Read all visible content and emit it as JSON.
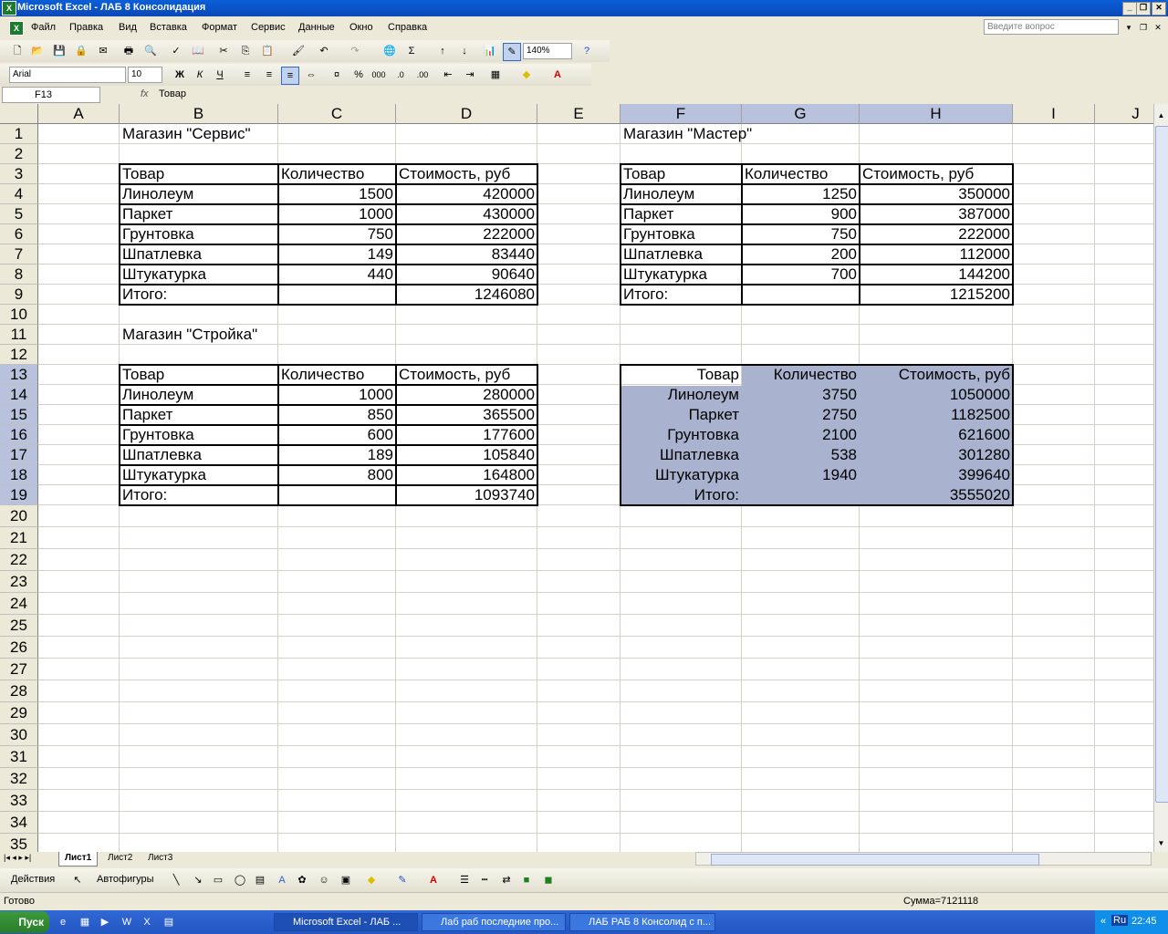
{
  "window": {
    "title": "Microsoft Excel - ЛАБ 8 Консолидация"
  },
  "menu": {
    "items": [
      "Файл",
      "Правка",
      "Вид",
      "Вставка",
      "Формат",
      "Сервис",
      "Данные",
      "Окно",
      "Справка"
    ],
    "help_placeholder": "Введите вопрос"
  },
  "toolbar": {
    "zoom": "140%",
    "font": "Arial",
    "size": "10"
  },
  "formula_bar": {
    "name_box": "F13",
    "fx": "fx",
    "content": "Товар"
  },
  "columns": [
    "A",
    "B",
    "C",
    "D",
    "E",
    "F",
    "G",
    "H",
    "I",
    "J"
  ],
  "rows": [
    "1",
    "2",
    "3",
    "4",
    "5",
    "6",
    "7",
    "8",
    "9",
    "10",
    "11",
    "12",
    "13",
    "14",
    "15",
    "16",
    "17",
    "18",
    "19",
    "20",
    "21",
    "22",
    "23",
    "24",
    "25",
    "26",
    "27",
    "28",
    "29",
    "30",
    "31",
    "32",
    "33",
    "34",
    "35"
  ],
  "sheet": {
    "servis": {
      "title": "Магазин \"Сервис\"",
      "headers": [
        "Товар",
        "Количество",
        "Стоимость, руб"
      ],
      "rows": [
        [
          "Линолеум",
          "1500",
          "420000"
        ],
        [
          "Паркет",
          "1000",
          "430000"
        ],
        [
          "Грунтовка",
          "750",
          "222000"
        ],
        [
          "Шпатлевка",
          "149",
          "83440"
        ],
        [
          "Штукатурка",
          "440",
          "90640"
        ]
      ],
      "total_label": "Итого:",
      "total": "1246080"
    },
    "master": {
      "title": "Магазин \"Мастер\"",
      "headers": [
        "Товар",
        "Количество",
        "Стоимость, руб"
      ],
      "rows": [
        [
          "Линолеум",
          "1250",
          "350000"
        ],
        [
          "Паркет",
          "900",
          "387000"
        ],
        [
          "Грунтовка",
          "750",
          "222000"
        ],
        [
          "Шпатлевка",
          "200",
          "112000"
        ],
        [
          "Штукатурка",
          "700",
          "144200"
        ]
      ],
      "total_label": "Итого:",
      "total": "1215200"
    },
    "stroyka": {
      "title": "Магазин \"Стройка\"",
      "headers": [
        "Товар",
        "Количество",
        "Стоимость, руб"
      ],
      "rows": [
        [
          "Линолеум",
          "1000",
          "280000"
        ],
        [
          "Паркет",
          "850",
          "365500"
        ],
        [
          "Грунтовка",
          "600",
          "177600"
        ],
        [
          "Шпатлевка",
          "189",
          "105840"
        ],
        [
          "Штукатурка",
          "800",
          "164800"
        ]
      ],
      "total_label": "Итого:",
      "total": "1093740"
    },
    "consolidated": {
      "headers": [
        "Товар",
        "Количество",
        "Стоимость, руб"
      ],
      "rows": [
        [
          "Линолеум",
          "3750",
          "1050000"
        ],
        [
          "Паркет",
          "2750",
          "1182500"
        ],
        [
          "Грунтовка",
          "2100",
          "621600"
        ],
        [
          "Шпатлевка",
          "538",
          "301280"
        ],
        [
          "Штукатурка",
          "1940",
          "399640"
        ]
      ],
      "total_label": "Итого:",
      "total": "3555020"
    }
  },
  "sheet_tabs": [
    "Лист1",
    "Лист2",
    "Лист3"
  ],
  "drawing": {
    "actions": "Действия",
    "autoshapes": "Автофигуры"
  },
  "status": {
    "ready": "Готово",
    "sum": "Сумма=7121118"
  },
  "taskbar": {
    "start": "Пуск",
    "tasks": [
      "Microsoft Excel - ЛАБ ...",
      "Лаб раб последние про...",
      "ЛАБ РАБ 8 Консолид с п..."
    ],
    "lang": "Ru",
    "clock": "22:45"
  },
  "colors": {
    "selection": "#a9b3cf",
    "title_bar": "#0a5fd8",
    "taskbar": "#3168d5"
  }
}
